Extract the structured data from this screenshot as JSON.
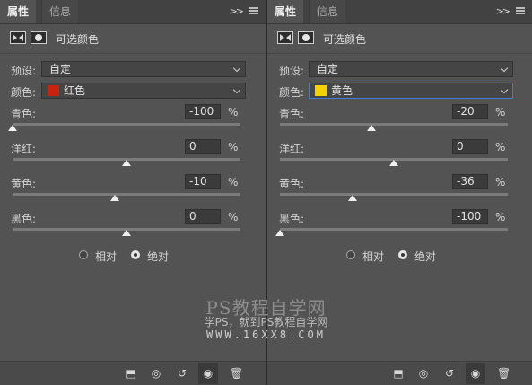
{
  "colors": {
    "panel_bg": "#535353",
    "red_swatch": "#c8230e",
    "yellow_swatch": "#f3d200",
    "focus_border": "#3e7fd6"
  },
  "panels": [
    {
      "tab_active": "属性",
      "tab_inactive": "信息",
      "collapse_icon": "double-chevron-right",
      "menu_icon": "menu-lines",
      "header_title": "可选颜色",
      "preset_label": "预设:",
      "preset_value": "自定",
      "color_label": "颜色:",
      "color_value": "红色",
      "color_swatch": "#c8230e",
      "sliders": [
        {
          "label": "青色:",
          "value": "-100",
          "unit": "%",
          "fraction": 0.0
        },
        {
          "label": "洋红:",
          "value": "0",
          "unit": "%",
          "fraction": 0.5
        },
        {
          "label": "黄色:",
          "value": "-10",
          "unit": "%",
          "fraction": 0.45
        },
        {
          "label": "黑色:",
          "value": "0",
          "unit": "%",
          "fraction": 0.5
        }
      ],
      "radio_relative": "相对",
      "radio_absolute": "绝对",
      "radio_selected": "absolute",
      "bottom_icons": [
        "clip-to-layer-icon",
        "view-previous-icon",
        "reset-icon",
        "visibility-eye-icon",
        "trash-icon"
      ]
    },
    {
      "tab_active": "属性",
      "tab_inactive": "信息",
      "collapse_icon": "double-chevron-right",
      "menu_icon": "menu-lines",
      "header_title": "可选颜色",
      "preset_label": "预设:",
      "preset_value": "自定",
      "color_label": "颜色:",
      "color_value": "黄色",
      "color_swatch": "#f3d200",
      "sliders": [
        {
          "label": "青色:",
          "value": "-20",
          "unit": "%",
          "fraction": 0.4
        },
        {
          "label": "洋红:",
          "value": "0",
          "unit": "%",
          "fraction": 0.5
        },
        {
          "label": "黄色:",
          "value": "-36",
          "unit": "%",
          "fraction": 0.32
        },
        {
          "label": "黑色:",
          "value": "-100",
          "unit": "%",
          "fraction": 0.0
        }
      ],
      "radio_relative": "相对",
      "radio_absolute": "绝对",
      "radio_selected": "absolute",
      "bottom_icons": [
        "clip-to-layer-icon",
        "view-previous-icon",
        "reset-icon",
        "visibility-eye-icon",
        "trash-icon"
      ]
    }
  ],
  "watermark": {
    "line1": "PS教程自学网",
    "line2": "学PS，就到PS教程自学网",
    "line3": "WWW.16XX8.COM"
  }
}
